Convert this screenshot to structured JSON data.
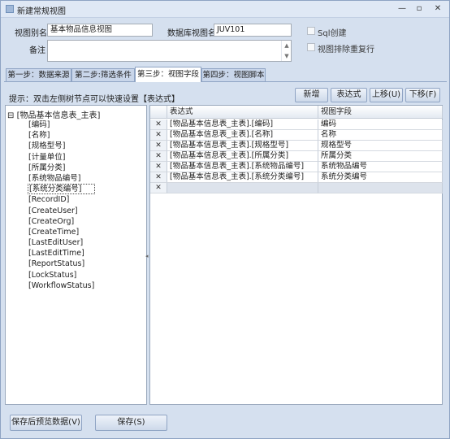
{
  "window": {
    "title": "新建常规视图",
    "minimize": "—",
    "maximize": "▫",
    "close": "✕"
  },
  "form": {
    "alias_label": "视图别名",
    "alias_value": "基本物品信息视图",
    "db_view_label": "数据库视图名",
    "db_view_value": "JUV101",
    "remark_label": "备注",
    "remark_value": "",
    "sql_create_label": "Sql创建",
    "sql_create_checked": false,
    "distinct_label": "视图排除重复行",
    "distinct_checked": false
  },
  "tabs": [
    {
      "label": "第一步：数据来源"
    },
    {
      "label": "第二步:筛选条件"
    },
    {
      "label": "第三步：视图字段"
    },
    {
      "label": "第四步：视图脚本"
    }
  ],
  "active_tab": 2,
  "hint": "提示：双击左侧树节点可以快速设置【表达式】",
  "buttons": {
    "add": "新增",
    "expression": "表达式",
    "move_up": "上移(U)",
    "move_down": "下移(F)"
  },
  "tree": {
    "root_toggle": "⊟",
    "root": "[物品基本信息表_主表]",
    "items": [
      "[编码]",
      "[名称]",
      "[规格型号]",
      "[计量单位]",
      "[所属分类]",
      "[系统物品编号]",
      "[系统分类编号]",
      "[RecordID]",
      "[CreateUser]",
      "[CreateOrg]",
      "[CreateTime]",
      "[LastEditUser]",
      "[LastEditTime]",
      "[ReportStatus]",
      "[LockStatus]",
      "[WorkflowStatus]"
    ],
    "selected_index": 6
  },
  "grid": {
    "columns": [
      "表达式",
      "视图字段"
    ],
    "delete_glyph": "✕",
    "rows": [
      {
        "expression": "[物品基本信息表_主表].[编码]",
        "field": "编码"
      },
      {
        "expression": "[物品基本信息表_主表].[名称]",
        "field": "名称"
      },
      {
        "expression": "[物品基本信息表_主表].[规格型号]",
        "field": "规格型号"
      },
      {
        "expression": "[物品基本信息表_主表].[所属分类]",
        "field": "所属分类"
      },
      {
        "expression": "[物品基本信息表_主表].[系统物品编号]",
        "field": "系统物品编号"
      },
      {
        "expression": "[物品基本信息表_主表].[系统分类编号]",
        "field": "系统分类编号"
      }
    ]
  },
  "footer": {
    "preview": "保存后预览数据(V)",
    "save": "保存(S)"
  }
}
